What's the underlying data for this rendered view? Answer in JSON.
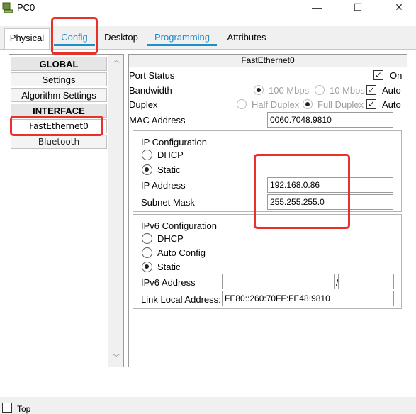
{
  "window": {
    "title": "PC0"
  },
  "tabs": [
    {
      "label": "Physical"
    },
    {
      "label": "Config"
    },
    {
      "label": "Desktop"
    },
    {
      "label": "Programming"
    },
    {
      "label": "Attributes"
    }
  ],
  "sidebar": {
    "items": [
      {
        "label": "GLOBAL"
      },
      {
        "label": "Settings"
      },
      {
        "label": "Algorithm Settings"
      },
      {
        "label": "INTERFACE"
      },
      {
        "label": "FastEthernet0"
      },
      {
        "label": "Bluetooth"
      }
    ]
  },
  "interface": {
    "title": "FastEthernet0",
    "port_status_label": "Port Status",
    "on_label": "On",
    "bandwidth_label": "Bandwidth",
    "bw_100": "100 Mbps",
    "bw_10": "10 Mbps",
    "auto_label": "Auto",
    "duplex_label": "Duplex",
    "half_duplex": "Half Duplex",
    "full_duplex": "Full Duplex",
    "mac_label": "MAC Address",
    "mac_value": "0060.7048.9810"
  },
  "ipv4": {
    "title": "IP Configuration",
    "dhcp": "DHCP",
    "static": "Static",
    "ip_label": "IP Address",
    "ip_value": "192.168.0.86",
    "mask_label": "Subnet Mask",
    "mask_value": "255.255.255.0"
  },
  "ipv6": {
    "title": "IPv6 Configuration",
    "dhcp": "DHCP",
    "auto_config": "Auto Config",
    "static": "Static",
    "addr_label": "IPv6 Address",
    "addr_value": "",
    "prefix_sep": "/",
    "prefix_value": "",
    "link_local_label": "Link Local Address:",
    "link_local_value": "FE80::260:70FF:FE48:9810"
  },
  "bottom": {
    "top_label": "Top"
  },
  "colors": {
    "tab_link": "#1e8fd0",
    "highlight": "#e8312a"
  }
}
